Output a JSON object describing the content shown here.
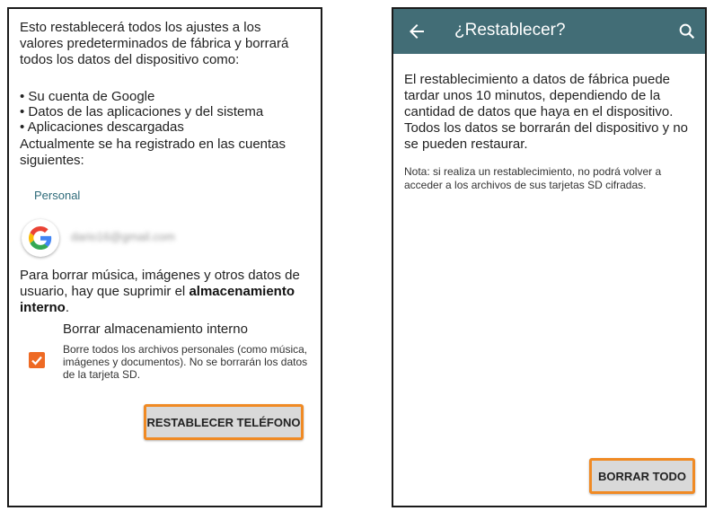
{
  "left": {
    "intro": "Esto restablecerá todos los ajustes a los valores predeterminados de fábrica y borrará todos los datos del dispositivo como:",
    "bullets": [
      "Su cuenta de Google",
      "Datos de las aplicaciones y del sistema",
      "Aplicaciones descargadas"
    ],
    "accounts_text": "Actualmente se ha registrado en las cuentas siguientes:",
    "section_label": "Personal",
    "account_email": "dario16@gmail.com",
    "erase_text_prefix": "Para borrar música, imágenes y otros datos de usuario, hay que suprimir el ",
    "erase_text_bold": "almacenamiento interno",
    "erase_text_suffix": ".",
    "internal_storage_title": "Borrar almacenamiento interno",
    "internal_storage_desc": "Borre todos los archivos personales (como música, imágenes y documentos). No se borrarán los datos de la tarjeta SD.",
    "reset_button": "RESTABLECER TELÉFONO"
  },
  "right": {
    "title": "¿Restablecer?",
    "warning": "El restablecimiento a datos de fábrica puede tardar unos 10 minutos, dependiendo de la cantidad de datos que haya en el dispositivo. Todos los datos se borrarán del dispositivo y no se pueden restaurar.",
    "note": "Nota: si realiza un restablecimiento, no podrá volver a acceder a los archivos de sus tarjetas SD cifradas.",
    "erase_button": "BORRAR TODO"
  },
  "icons": {
    "back": "back-arrow-icon",
    "search": "search-icon",
    "google": "google-logo-icon",
    "checkbox": "checkbox-checked-icon"
  },
  "colors": {
    "appbar": "#426d76",
    "highlight_border": "#f08a24",
    "checkbox": "#ee6a24",
    "section_label": "#2e6b7a"
  }
}
